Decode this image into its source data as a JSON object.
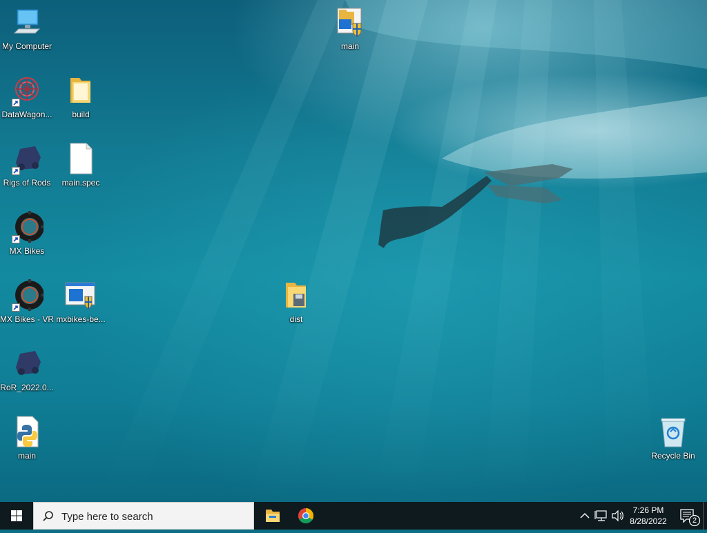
{
  "desktop": {
    "icons": [
      {
        "label": "My Computer"
      },
      {
        "label": "DataWagon..."
      },
      {
        "label": "Rigs of Rods"
      },
      {
        "label": "MX Bikes"
      },
      {
        "label": "MX Bikes - VR"
      },
      {
        "label": "RoR_2022.0..."
      },
      {
        "label": "main"
      },
      {
        "label": "build"
      },
      {
        "label": "main.spec"
      },
      {
        "label": "mxbikes-be..."
      },
      {
        "label": "main"
      },
      {
        "label": "dist"
      },
      {
        "label": "Recycle Bin"
      }
    ]
  },
  "taskbar": {
    "search_placeholder": "Type here to search",
    "apps": [
      "file-explorer-icon",
      "chrome-icon"
    ],
    "clock": {
      "time": "7:26 PM",
      "date": "8/28/2022"
    },
    "notifications_count": "2"
  },
  "colors": {
    "taskbar_bg": "#0f1a1f",
    "search_bg": "#f3f3f3",
    "water_deep": "#0d5f7a",
    "water_light": "#138aa0"
  }
}
